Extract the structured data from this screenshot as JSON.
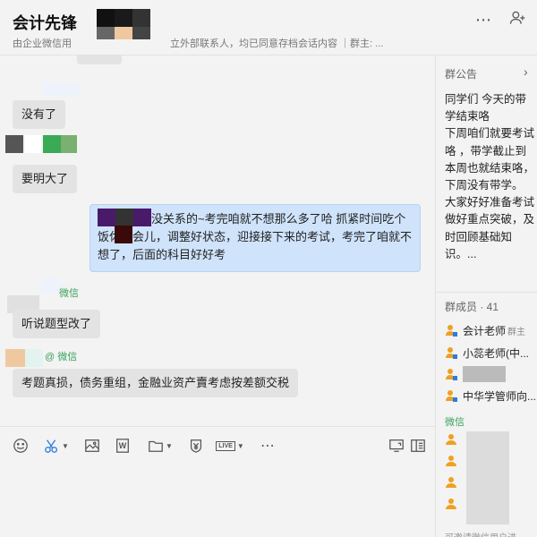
{
  "header": {
    "title": "会计先锋",
    "subtitle_prefix": "由企业微信用",
    "subtitle_suffix": "立外部联系人，均已同意存档会话内容 ｜群主: ...",
    "more_icon": "more-icon",
    "add_member_icon": "add-member-icon"
  },
  "messages": [
    {
      "text": "没有了"
    },
    {
      "text": "要明大了"
    },
    {
      "text": "没关系的~考完咱就不想那么多了哈  抓紧时间吃个饭休息会儿，调整好状态，迎接接下来的考试，考完了咱就不想了，后面的科目好好考"
    },
    {
      "sender": "微信",
      "text": "听说题型改了"
    },
    {
      "sender": "@ 微信",
      "text": "考题真损，债务重组，金融业资产賣考虑按差额交税"
    }
  ],
  "toolbar": {
    "icons": [
      "emoji-icon",
      "scissors-icon",
      "image-icon",
      "word-file-icon",
      "folder-icon",
      "money-icon",
      "live-icon",
      "more-icon",
      "screen-share-icon",
      "history-icon"
    ],
    "live_label": "LIVE",
    "word_label": "W"
  },
  "sidebar": {
    "notice_title": "群公告",
    "notice_text": "同学们 今天的带学结束咯\n下周咱们就要考试咯 ，带学截止到本周也就结束咯，下周没有带学。\n大家好好准备考试  做好重点突破，及时回顾基础知识。...",
    "members_title": "群成员 · 41",
    "members": [
      {
        "name": "会计老师",
        "tag": "群主"
      },
      {
        "name": "小蕊老师(中..."
      },
      {
        "name": ""
      },
      {
        "name": "中华学管师向..."
      }
    ],
    "wechat_title": "微信",
    "footer": "可邀请微信用户进..."
  }
}
